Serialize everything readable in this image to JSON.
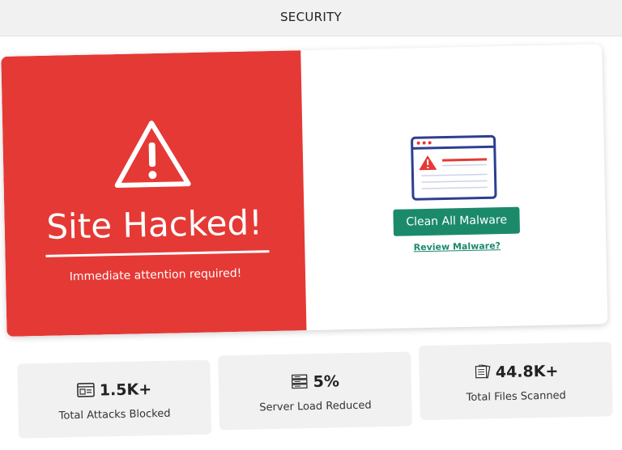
{
  "header": {
    "title": "SECURITY"
  },
  "alert": {
    "title": "Site Hacked!",
    "subtitle": "Immediate attention required!",
    "color": "#e53935"
  },
  "actions": {
    "clean_label": "Clean All Malware",
    "review_label": "Review Malware?",
    "accent_color": "#1b8a6b"
  },
  "stats": [
    {
      "icon": "firewall-browser-icon",
      "value": "1.5K+",
      "label": "Total Attacks Blocked"
    },
    {
      "icon": "server-icon",
      "value": "5%",
      "label": "Server Load Reduced"
    },
    {
      "icon": "files-icon",
      "value": "44.8K+",
      "label": "Total Files Scanned"
    }
  ]
}
